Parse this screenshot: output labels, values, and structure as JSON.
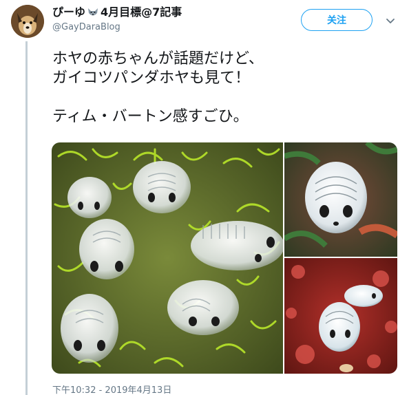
{
  "author": {
    "name_part1": "ぴーゆ",
    "name_part2": "4月目標@7記事",
    "handle": "@GayDaraBlog",
    "avatar_icon": "dog-avatar-icon",
    "name_emoji_icon": "wolf-emoji-icon"
  },
  "follow_button": {
    "label": "关注"
  },
  "menu_icon": "chevron-down-icon",
  "tweet": {
    "line1": "ホヤの赤ちゃんが話題だけど、",
    "line2": "ガイコツパンダホヤも見て！",
    "line3": "ティム・バートン感すごひ。"
  },
  "media": {
    "count": 3,
    "images": [
      {
        "name": "photo-skeleton-panda-sea-squirts-green-coral"
      },
      {
        "name": "photo-skeleton-panda-sea-squirt-closeup"
      },
      {
        "name": "photo-skeleton-panda-sea-squirts-red-reef"
      }
    ]
  },
  "timestamp": "下午10:32 - 2019年4月13日",
  "colors": {
    "accent": "#1da1f2",
    "secondary_text": "#657786",
    "thread_line": "#c4cfd6"
  }
}
